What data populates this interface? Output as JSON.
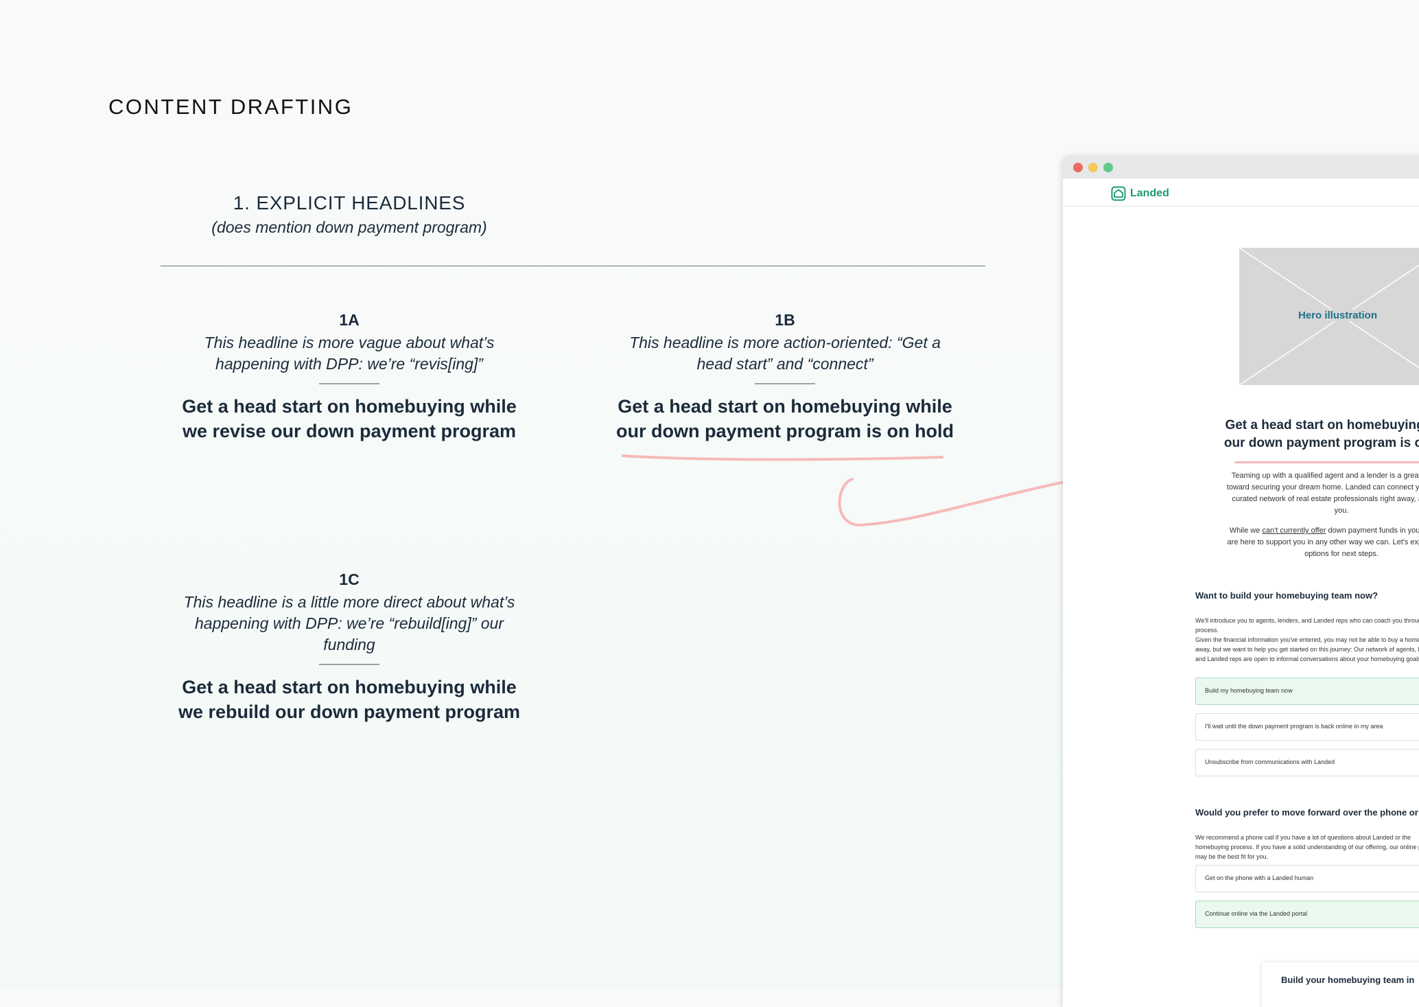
{
  "page_heading": "CONTENT DRAFTING",
  "section": {
    "title": "1. EXPLICIT HEADLINES",
    "subtitle": "(does mention down payment program)"
  },
  "options": [
    {
      "label": "1A",
      "note": "This headline is more vague about what’s happening with DPP: we’re “revis[ing]”",
      "headline": "Get a head start on homebuying while we revise our down payment program"
    },
    {
      "label": "1B",
      "note": "This headline is more action-oriented: “Get a head start” and “connect”",
      "headline": "Get a head start on homebuying while our down payment program is on hold"
    },
    {
      "label": "1C",
      "note": "This headline is a little more direct about what’s happening with DPP: we’re “rebuild[ing]” our funding",
      "headline": "Get a head start on homebuying while we rebuild our down payment program"
    }
  ],
  "colors": {
    "annotation": "#f7b9b9",
    "brand": "#1c9b6a",
    "text": "#1c2b3a"
  },
  "mockup": {
    "brand": "Landed",
    "hero_label": "Hero illustration",
    "headline": "Get a head start on homebuying while our down payment program is on hold",
    "body_1": "Teaming up with a qualified agent and a lender is a great first step toward securing your dream home. Landed can connect you with our curated network of real estate professionals right away, at no cost you.",
    "body_2_before": "While we ",
    "body_2_link": "can't currently offer",
    "body_2_after": " down payment funds in your area, we are here to support you in any other way we can. Let's explore some options for next steps.",
    "team_heading": "Want to build your homebuying team now?",
    "team_text_1": "We'll introduce you to agents, lenders, and Landed reps who can coach you through the process.",
    "team_text_2": "Given the financial information you've entered, you may not be able to buy a home right away, but we want to help you get started on this journey: Our network of agents, lenders, and Landed reps are open to informal conversations about your homebuying goals.",
    "choices": [
      "Build my homebuying team now",
      "I'll wait until the down payment program is back online in my area",
      "Unsubscribe from communications with Landed"
    ],
    "phone_heading": "Would you prefer to move forward over the phone or online?",
    "phone_text": "We recommend a phone call if you have a lot of questions about Landed or the homebuying process. If you have a solid understanding of our offering, our online portal may be the best fit for you.",
    "phone_choices": [
      "Get on the phone with a Landed human",
      "Continue online via the Landed portal"
    ],
    "card_title": "Build your homebuying team in"
  }
}
